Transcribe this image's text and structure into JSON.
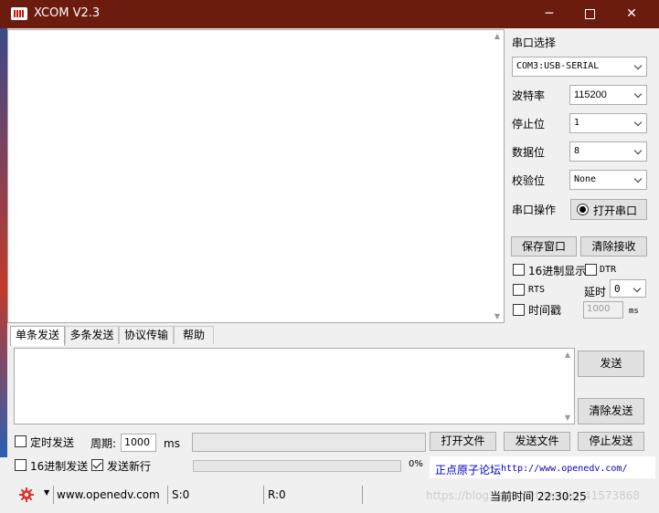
{
  "window": {
    "title": "XCOM V2.3"
  },
  "serial": {
    "port_section_label": "串口选择",
    "port_value": "COM3:USB-SERIAL",
    "baud_label": "波特率",
    "baud_value": "115200",
    "stop_label": "停止位",
    "stop_value": "1",
    "data_label": "数据位",
    "data_value": "8",
    "parity_label": "校验位",
    "parity_value": "None",
    "op_label": "串口操作",
    "open_button": "打开串口"
  },
  "receive": {
    "save_button": "保存窗口",
    "clear_button": "清除接收",
    "hex_display_label": "16进制显示",
    "dtr_label": "DTR",
    "rts_label": "RTS",
    "delay_label": "延时",
    "delay_value": "0",
    "timestamp_label": "时间戳",
    "timestamp_value": "1000",
    "timestamp_unit": "ms"
  },
  "tabs": [
    "单条发送",
    "多条发送",
    "协议传输",
    "帮助"
  ],
  "send": {
    "send_button": "发送",
    "clear_send_button": "清除发送",
    "timed_send_label": "定时发送",
    "period_label": "周期:",
    "period_value": "1000",
    "period_unit": "ms",
    "open_file_button": "打开文件",
    "send_file_button": "发送文件",
    "stop_send_button": "停止发送",
    "hex_send_label": "16进制发送",
    "newline_label": "发送新行",
    "progress_text": "0%",
    "progress_value": 0,
    "forum_label": "正点原子论坛",
    "forum_url": "http://www.openedv.com/"
  },
  "status": {
    "website": "www.openedv.com",
    "sent": "S:0",
    "received": "R:0",
    "time_label": "当前时间 22:30:25",
    "watermark": "https://blog.csdn.net/weixin_41573868"
  },
  "icons": {
    "app": "xcom-app-icon",
    "minimize": "minimize-icon",
    "maximize": "maximize-icon",
    "close": "close-icon",
    "gear": "gear-icon",
    "radio": "radio-dot-icon"
  },
  "colors": {
    "titlebar": "#6b1c0e",
    "gear": "#d9312c",
    "link": "#0000cc"
  }
}
